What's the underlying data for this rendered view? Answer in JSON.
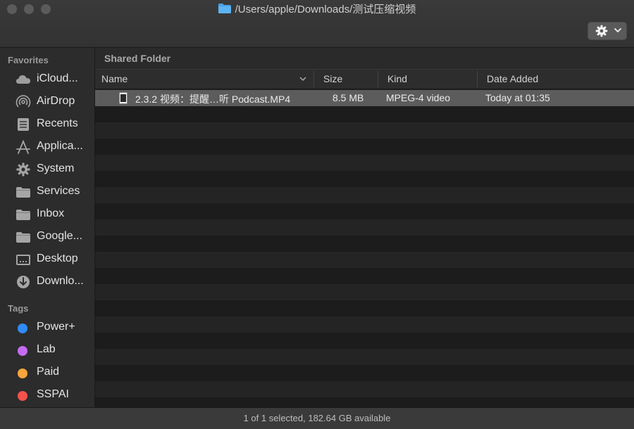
{
  "window": {
    "title": "/Users/apple/Downloads/测试压缩视频",
    "icons": {
      "gear_button": "gear-icon"
    }
  },
  "sidebar": {
    "favorites_header": "Favorites",
    "favorites": [
      {
        "label": "iCloud...",
        "icon": "cloud-icon"
      },
      {
        "label": "AirDrop",
        "icon": "airdrop-icon"
      },
      {
        "label": "Recents",
        "icon": "recents-icon"
      },
      {
        "label": "Applica...",
        "icon": "applications-icon"
      },
      {
        "label": "System",
        "icon": "gear-icon"
      },
      {
        "label": "Services",
        "icon": "folder-icon"
      },
      {
        "label": "Inbox",
        "icon": "folder-icon"
      },
      {
        "label": "Google...",
        "icon": "folder-icon"
      },
      {
        "label": "Desktop",
        "icon": "desktop-icon"
      },
      {
        "label": "Downlo...",
        "icon": "downloads-icon"
      }
    ],
    "tags_header": "Tags",
    "tags": [
      {
        "label": "Power+",
        "color": "#2f8cf5"
      },
      {
        "label": "Lab",
        "color": "#c46cf0"
      },
      {
        "label": "Paid",
        "color": "#f6a63a"
      },
      {
        "label": "SSPAI",
        "color": "#f5524b"
      }
    ]
  },
  "main": {
    "section_title": "Shared Folder",
    "columns": {
      "name": "Name",
      "size": "Size",
      "kind": "Kind",
      "date_added": "Date Added"
    },
    "files": [
      {
        "name": "2.3.2 视频：提醒…听 Podcast.MP4",
        "size": "8.5 MB",
        "kind": "MPEG-4 video",
        "date_added": "Today at 01:35",
        "selected": true,
        "icon": "video-file-icon"
      }
    ]
  },
  "status_bar": {
    "text": "1 of 1 selected, 182.64 GB available"
  }
}
